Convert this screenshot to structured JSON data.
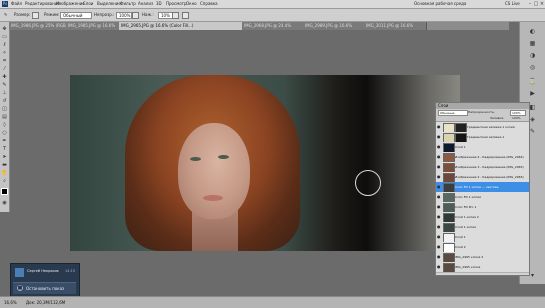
{
  "app": {
    "logo": "Ps"
  },
  "menubar": {
    "items": [
      "Файл",
      "Редактирование",
      "Изображение",
      "Слои",
      "Выделение",
      "Фильтр",
      "Анализ",
      "3D",
      "Просмотр",
      "Окно",
      "Справка"
    ],
    "workspace": "Основная рабочая среда",
    "cs_live": "CS Live"
  },
  "options": {
    "size_label": "Размер:",
    "mode_label": "Режим:",
    "mode_value": "Обычный",
    "opacity_label": "Непрозр.:",
    "opacity_value": "100%",
    "flow_label": "Наж.:",
    "flow_value": "10%"
  },
  "tabs": [
    {
      "label": "IMG_1986.JPG @ 25% (RGB/8)",
      "active": false
    },
    {
      "label": "IMG_1985.JPG @ 16.6%",
      "active": false
    },
    {
      "label": "IMG_2965.JPG @ 16.6% (Color Fill...)",
      "active": true
    },
    {
      "label": "IMG_2968.JPG @ 24.4%",
      "active": false
    },
    {
      "label": "IMG_2989.JPG @ 16.6%",
      "active": false
    },
    {
      "label": "IMG_3011.JPG @ 16.6%",
      "active": false
    }
  ],
  "tools": [
    "move",
    "marquee",
    "lasso",
    "quick-select",
    "crop",
    "eyedropper",
    "heal",
    "brush",
    "stamp",
    "history",
    "eraser",
    "gradient",
    "blur",
    "dodge",
    "pen",
    "type",
    "path-select",
    "shape",
    "hand",
    "zoom"
  ],
  "layers": {
    "title": "Слои",
    "blend_mode": "Обычные",
    "opacity_label": "Непрозрачность:",
    "opacity_value": "100%",
    "fill_label": "Заливка:",
    "fill_value": "100%",
    "items": [
      {
        "name": "Градиентная заливка 1 копия",
        "thumb": "#e8e3c8",
        "mask": "#222222",
        "selected": false
      },
      {
        "name": "Градиентная заливка 1",
        "thumb": "#d9d3b0",
        "mask": "#151515",
        "selected": false
      },
      {
        "name": "Слой 1",
        "thumb": "#0f1a2e",
        "mask": "",
        "selected": false
      },
      {
        "name": "Изображение 4 - Кадрирование (IMG_2965)",
        "thumb": "#8a5a44",
        "mask": "",
        "selected": false
      },
      {
        "name": "Изображение 3 - Кадрирование (IMG_2965)",
        "thumb": "#7a4f3c",
        "mask": "",
        "selected": false
      },
      {
        "name": "Изображение 2 - Кадрирование (IMG_2965)",
        "thumb": "#6e4838",
        "mask": "",
        "selected": false
      },
      {
        "name": "Color Fill 1 копия — светлее",
        "thumb": "#3d3d3d",
        "mask": "",
        "selected": true
      },
      {
        "name": "Color Fill 1 копия",
        "thumb": "#556b62",
        "mask": "",
        "selected": false
      },
      {
        "name": "Color Fill Pro 1",
        "thumb": "#4d5d57",
        "mask": "",
        "selected": false
      },
      {
        "name": "Слой 1 копия 2",
        "thumb": "#2f3a36",
        "mask": "",
        "selected": false
      },
      {
        "name": "Слой 1 копия",
        "thumb": "#3a4742",
        "mask": "",
        "selected": false
      },
      {
        "name": "Слой 1",
        "thumb": "#f2f2f2",
        "mask": "",
        "selected": false
      },
      {
        "name": "Слой 2",
        "thumb": "#ffffff",
        "mask": "",
        "selected": false
      },
      {
        "name": "IMG_2965 копия 2",
        "thumb": "#5a4a40",
        "mask": "",
        "selected": false
      },
      {
        "name": "IMG_2965 копия",
        "thumb": "#5a4a40",
        "mask": "",
        "selected": false
      }
    ]
  },
  "status": {
    "zoom": "16,6%",
    "doc": "Док: 20,3M/112,6M"
  },
  "notification": {
    "title": "Сергей Некрасов",
    "time": "14:15",
    "button_label": "Остановить показ"
  },
  "colors": {
    "accent": "#3d8ee6",
    "notify_bg": "#2a3a4e"
  }
}
